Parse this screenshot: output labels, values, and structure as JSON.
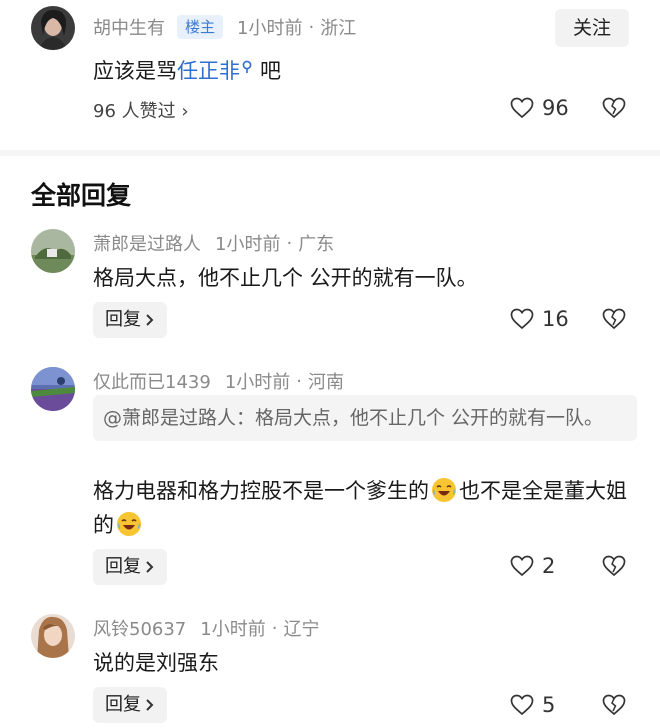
{
  "top_comment": {
    "author": "胡中生有",
    "badge": "楼主",
    "time": "1小时前",
    "location": "浙江",
    "follow_label": "关注",
    "text_before": "应该是骂",
    "link_text": "任正非",
    "text_after": "吧",
    "likers": "96 人赞过 ›",
    "like_count": "96"
  },
  "section_title": "全部回复",
  "replies": [
    {
      "author": "萧郎是过路人",
      "time": "1小时前",
      "location": "广东",
      "text": "格局大点，他不止几个 公开的就有一队。",
      "reply_label": "回复",
      "like_count": "16"
    },
    {
      "author": "仅此而已1439",
      "time": "1小时前",
      "location": "河南",
      "quote": "@萧郎是过路人：格局大点，他不止几个 公开的就有一队。",
      "text_part1": "格力电器和格力控股不是一个爹生的",
      "text_part2": "也不是全是董大姐的",
      "reply_label": "回复",
      "like_count": "2"
    },
    {
      "author": "风铃50637",
      "time": "1小时前",
      "location": "辽宁",
      "text": "说的是刘强东",
      "reply_label": "回复",
      "like_count": "5"
    }
  ],
  "colors": {
    "link": "#2f6fd0",
    "badge_text": "#3c7bd2",
    "badge_bg": "#e8f0fb",
    "meta": "#8a8a8a"
  },
  "icons": [
    "heart-icon",
    "broken-heart-icon",
    "search-icon",
    "chevron-right-icon",
    "laughing-crying-emoji"
  ]
}
